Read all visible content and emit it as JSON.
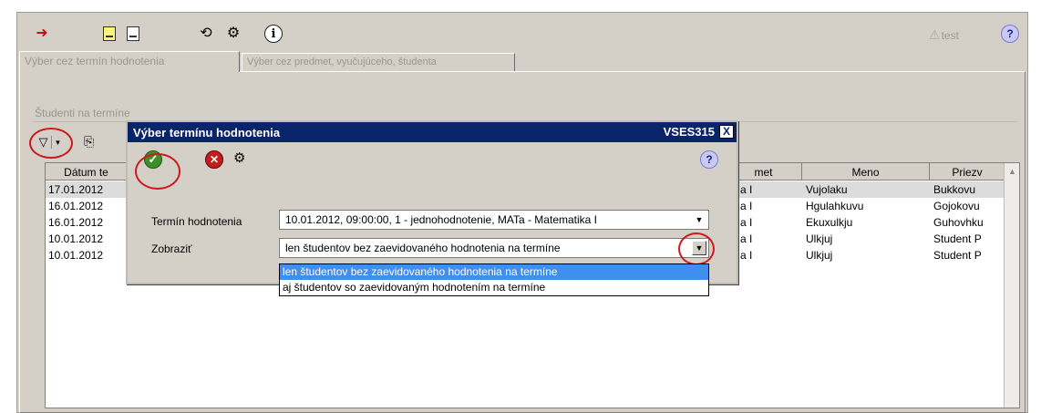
{
  "toolbar": {
    "exit_icon": "exit-icon",
    "test_label": "test"
  },
  "tabs": [
    {
      "label": "Výber cez termín hodnotenia"
    },
    {
      "label": "Výber cez predmet, vyučujúceho, študenta"
    }
  ],
  "group": {
    "title": "Študenti na termíne"
  },
  "grid": {
    "columns": [
      {
        "label": "Dátum te"
      },
      {
        "label": "met"
      },
      {
        "label": "Meno"
      },
      {
        "label": "Priezv"
      }
    ],
    "rows": [
      {
        "date": "17.01.2012",
        "subject": "a I",
        "first": "Vujolaku",
        "last": "Bukkovu"
      },
      {
        "date": "16.01.2012",
        "subject": "a I",
        "first": "Hgulahkuvu",
        "last": "Gojokovu"
      },
      {
        "date": "16.01.2012",
        "subject": "a I",
        "first": "Ekuxulkju",
        "last": "Guhovhku"
      },
      {
        "date": "10.01.2012",
        "subject": "a I",
        "first": "Ulkjuj",
        "last": "Student P"
      },
      {
        "date": "10.01.2012",
        "subject": "a I",
        "first": "Ulkjuj",
        "last": "Student P"
      }
    ]
  },
  "dialog": {
    "title": "Výber termínu hodnotenia",
    "code": "VSES315",
    "close": "X",
    "term_label": "Termín hodnotenia",
    "term_value": "10.01.2012, 09:00:00, 1 - jednohodnotenie, MATa - Matematika I",
    "show_label": "Zobraziť",
    "show_value": "len študentov bez zaevidovaného hodnotenia na termíne",
    "options": [
      "len študentov bez zaevidovaného hodnotenia na termíne",
      "aj študentov so zaevidovaným hodnotením na termíne"
    ]
  }
}
